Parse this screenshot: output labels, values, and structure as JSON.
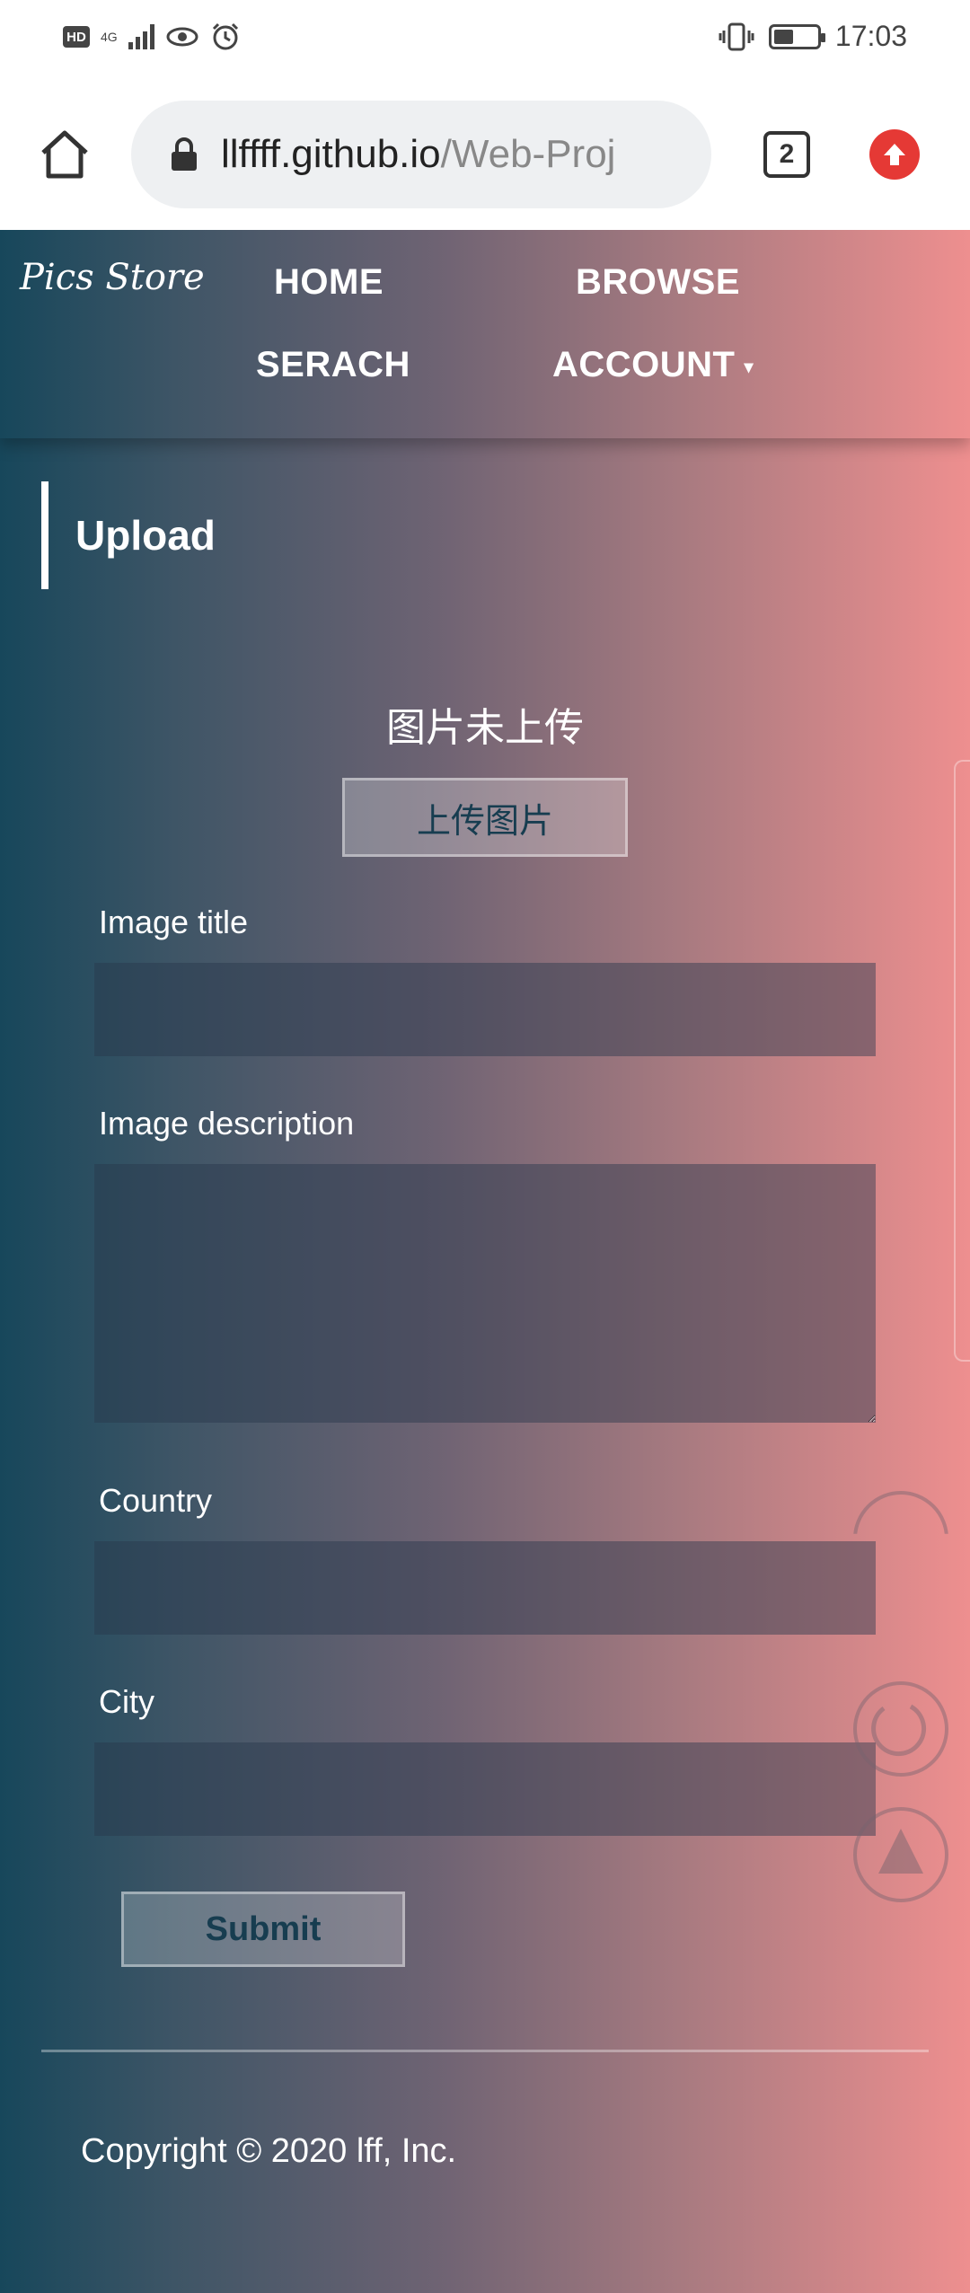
{
  "status_bar": {
    "network_badge": "HD",
    "network_type": "4G",
    "time": "17:03",
    "battery_level": 0.4
  },
  "browser": {
    "url_host": "llffff.github.io",
    "url_path": "/Web-Proj",
    "tab_count": "2"
  },
  "navbar": {
    "brand": "Pics Store",
    "links": {
      "home": "HOME",
      "browse": "BROWSE",
      "search": "SERACH",
      "account": "ACCOUNT"
    },
    "account_caret": "▾"
  },
  "upload": {
    "section_title": "Upload",
    "status_text": "图片未上传",
    "upload_button": "上传图片"
  },
  "form": {
    "title_label": "Image title",
    "title_value": "",
    "description_label": "Image description",
    "description_value": "",
    "country_label": "Country",
    "country_value": "",
    "city_label": "City",
    "city_value": "",
    "submit_label": "Submit"
  },
  "footer": {
    "copyright": "Copyright © 2020 lff, Inc."
  },
  "colors": {
    "gradient_left": "#17475b",
    "gradient_right": "#ee8f8f",
    "accent_red": "#e53935",
    "button_text": "#173d50"
  },
  "icons": {
    "home": "home-icon",
    "lock": "lock-icon",
    "update": "arrow-up-icon",
    "refresh": "refresh-icon",
    "scroll_top": "triangle-up-icon"
  }
}
